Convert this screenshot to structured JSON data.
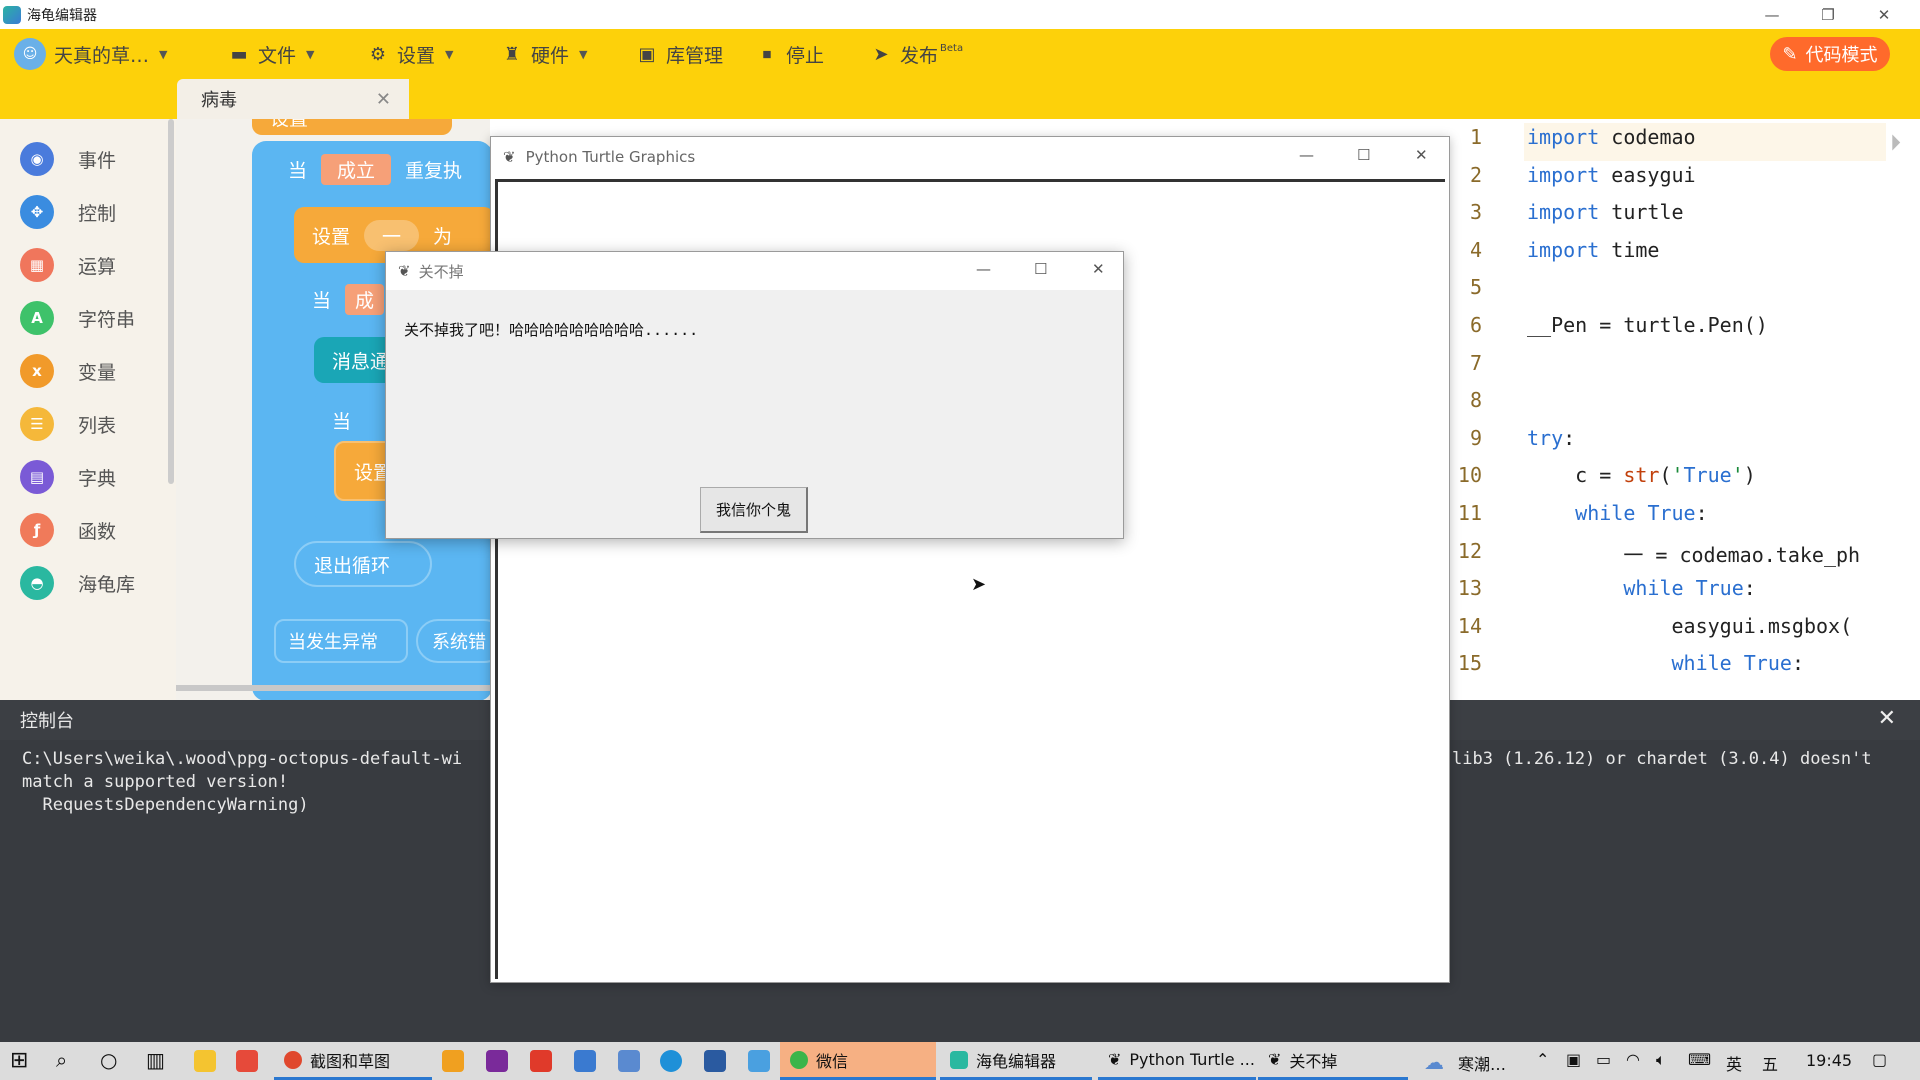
{
  "app_window": {
    "title": "海龟编辑器",
    "toolbar": {
      "user_label": "天真的草…",
      "file_label": "文件",
      "settings_label": "设置",
      "hardware_label": "硬件",
      "library_label": "库管理",
      "stop_label": "停止",
      "publish_label": "发布",
      "publish_badge": "Beta",
      "code_mode_label": "代码模式"
    },
    "tab": {
      "label": "病毒"
    },
    "categories": [
      "事件",
      "控制",
      "运算",
      "字符串",
      "变量",
      "列表",
      "字典",
      "函数",
      "海龟库"
    ],
    "category_colors": [
      "#4a7bdc",
      "#3a8ce0",
      "#f0765c",
      "#3ec26a",
      "#f19a2a",
      "#f5b83a",
      "#7a5ad6",
      "#f07a5a",
      "#2ab8a0"
    ],
    "blocks": {
      "top_partial": "设置",
      "when1": "当",
      "when1_value": "成立",
      "repeat": "重复执",
      "set1": "设置",
      "set1_value": "一",
      "set1_to": "为",
      "when2": "当",
      "when2_value": "成",
      "msg": "消息通",
      "when3": "当",
      "set2": "设置",
      "exit_loop": "退出循环",
      "on_exception": "当发生异常",
      "system_error": "系统错"
    }
  },
  "code_editor": {
    "lines": [
      {
        "n": "1",
        "text": "import codemao"
      },
      {
        "n": "2",
        "text": "import easygui"
      },
      {
        "n": "3",
        "text": "import turtle"
      },
      {
        "n": "4",
        "text": "import time"
      },
      {
        "n": "5",
        "text": ""
      },
      {
        "n": "6",
        "text": "__Pen = turtle.Pen()"
      },
      {
        "n": "7",
        "text": ""
      },
      {
        "n": "8",
        "text": ""
      },
      {
        "n": "9",
        "text": "try:"
      },
      {
        "n": "10",
        "text": "    c = str('True')"
      },
      {
        "n": "11",
        "text": "    while True:"
      },
      {
        "n": "12",
        "text": "        一 = codemao.take_ph"
      },
      {
        "n": "13",
        "text": "        while True:"
      },
      {
        "n": "14",
        "text": "            easygui.msgbox("
      },
      {
        "n": "15",
        "text": "            while True:"
      }
    ]
  },
  "console": {
    "title": "控制台",
    "line1_left": "C:\\Users\\weika\\.wood\\ppg-octopus-default-wi",
    "line1_right": "lib3 (1.26.12) or chardet (3.0.4) doesn't",
    "line2": "match a supported version!",
    "line3": "  RequestsDependencyWarning)"
  },
  "turtle_window": {
    "title": "Python Turtle Graphics"
  },
  "msgbox": {
    "title": "关不掉",
    "message": "关不掉我了吧！哈哈哈哈哈哈哈哈哈......",
    "button_label": "我信你个鬼"
  },
  "taskbar": {
    "tasks": [
      {
        "label": "截图和草图"
      },
      {
        "label": "微信"
      },
      {
        "label": "海龟编辑器"
      },
      {
        "label": "Python Turtle ..."
      },
      {
        "label": "关不掉"
      }
    ],
    "weather": "寒潮…",
    "ime1": "英",
    "ime2": "五",
    "time": "19:45"
  }
}
